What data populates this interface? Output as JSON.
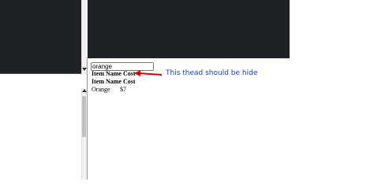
{
  "search": {
    "value": "orange"
  },
  "table": {
    "thead_sticky": {
      "header": "Item Name Cost"
    },
    "thead": {
      "header": "Item Name Cost"
    },
    "rows": [
      {
        "item": "Orange",
        "cost": "$7"
      }
    ]
  },
  "annotation": {
    "text": "This thead should be hide",
    "color": "#1a3fd6",
    "arrow_color": "#cc0000"
  }
}
